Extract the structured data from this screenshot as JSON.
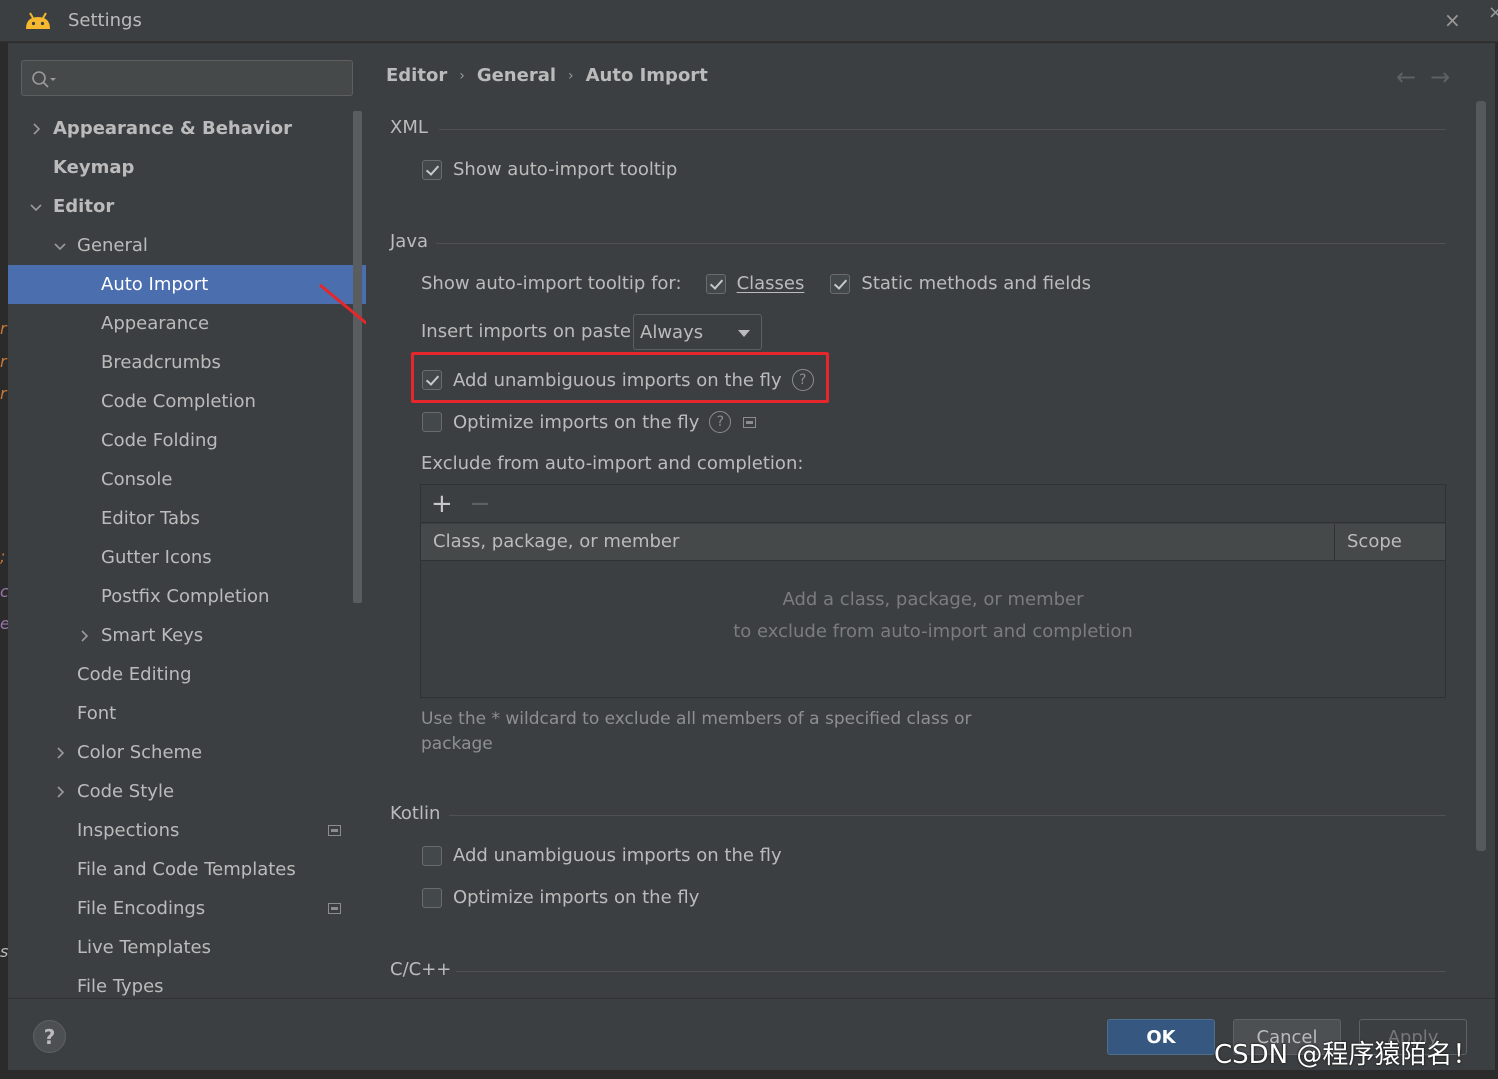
{
  "window": {
    "title": "Settings"
  },
  "sidebar": {
    "search_placeholder": "",
    "items": [
      {
        "label": "Appearance & Behavior"
      },
      {
        "label": "Keymap"
      },
      {
        "label": "Editor"
      },
      {
        "label": "General"
      },
      {
        "label": "Auto Import"
      },
      {
        "label": "Appearance"
      },
      {
        "label": "Breadcrumbs"
      },
      {
        "label": "Code Completion"
      },
      {
        "label": "Code Folding"
      },
      {
        "label": "Console"
      },
      {
        "label": "Editor Tabs"
      },
      {
        "label": "Gutter Icons"
      },
      {
        "label": "Postfix Completion"
      },
      {
        "label": "Smart Keys"
      },
      {
        "label": "Code Editing"
      },
      {
        "label": "Font"
      },
      {
        "label": "Color Scheme"
      },
      {
        "label": "Code Style"
      },
      {
        "label": "Inspections"
      },
      {
        "label": "File and Code Templates"
      },
      {
        "label": "File Encodings"
      },
      {
        "label": "Live Templates"
      },
      {
        "label": "File Types"
      }
    ]
  },
  "breadcrumb": {
    "items": [
      "Editor",
      "General",
      "Auto Import"
    ],
    "separator": "›"
  },
  "xml": {
    "title": "XML",
    "show_tooltip": "Show auto-import tooltip"
  },
  "java": {
    "title": "Java",
    "tooltip_for_label": "Show auto-import tooltip for:",
    "classes": "Classes",
    "static_methods": "Static methods and fields",
    "insert_on_paste_label": "Insert imports on paste:",
    "insert_on_paste_value": "Always",
    "add_unambiguous": "Add unambiguous imports on the fly",
    "optimize": "Optimize imports on the fly",
    "exclude_label": "Exclude from auto-import and completion:",
    "table_col_class": "Class, package, or member",
    "table_col_scope": "Scope",
    "empty_line1": "Add a class, package, or member",
    "empty_line2": "to exclude from auto-import and completion",
    "hint": "Use the * wildcard to exclude all members of a specified class or package"
  },
  "kotlin": {
    "title": "Kotlin",
    "add_unambiguous": "Add unambiguous imports on the fly",
    "optimize": "Optimize imports on the fly"
  },
  "cpp": {
    "title": "C/C++"
  },
  "footer": {
    "ok": "OK",
    "cancel": "Cancel",
    "apply": "Apply",
    "help": "?"
  },
  "watermark": "CSDN @程序猿陌名！",
  "icons": {
    "add": "+",
    "remove": "−",
    "back": "←",
    "forward": "→",
    "close": "×"
  },
  "colors": {
    "selection": "#4b6eaf",
    "highlight_box": "#e5262a",
    "ok_button": "#365880"
  }
}
